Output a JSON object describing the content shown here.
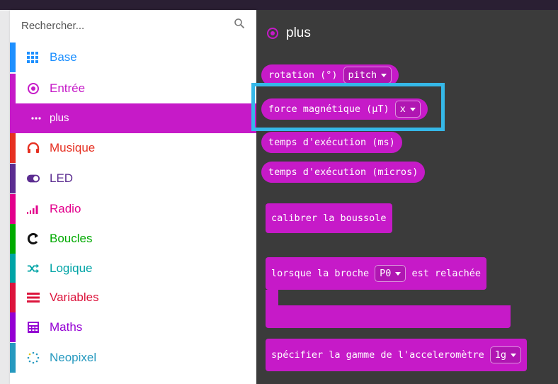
{
  "search": {
    "placeholder": "Rechercher..."
  },
  "categories": [
    {
      "label": "Base",
      "color": "#1e90ff",
      "icon": "grid-icon"
    },
    {
      "label": "Entrée",
      "color": "#c61ac8",
      "icon": "radio-target-icon"
    },
    {
      "label": "plus",
      "color": "#c61ac8",
      "icon": "more-dots-icon",
      "selected": true
    },
    {
      "label": "Musique",
      "color": "#e63022",
      "icon": "headphones-icon"
    },
    {
      "label": "LED",
      "color": "#5c2d91",
      "icon": "toggle-icon"
    },
    {
      "label": "Radio",
      "color": "#e3008c",
      "icon": "signal-bars-icon"
    },
    {
      "label": "Boucles",
      "color": "#00aa00",
      "icon": "loop-icon"
    },
    {
      "label": "Logique",
      "color": "#00a4a6",
      "icon": "shuffle-icon"
    },
    {
      "label": "Variables",
      "color": "#dc143c",
      "icon": "lines-icon"
    },
    {
      "label": "Maths",
      "color": "#9400d3",
      "icon": "calculator-icon"
    },
    {
      "label": "Neopixel",
      "color": "#2699bf",
      "icon": "dotted-circle-icon"
    }
  ],
  "flyout": {
    "title": "plus",
    "blocks": {
      "rotation": {
        "text": "rotation (°)",
        "dropdown": "pitch"
      },
      "force": {
        "text": "force magnétique (µT)",
        "dropdown": "x"
      },
      "temps_ms": {
        "text": "temps d'exécution (ms)"
      },
      "temps_micros": {
        "text": "temps d'exécution (micros)"
      },
      "calibrer": {
        "text": "calibrer la boussole"
      },
      "lorsque": {
        "text_before": "lorsque la broche",
        "dropdown": "P0",
        "text_after": "est relachée"
      },
      "specifier": {
        "text": "spécifier la gamme de l'acceleromètre",
        "dropdown": "1g"
      }
    }
  },
  "colors": {
    "block": "#c61ac8",
    "highlight": "#35b8e8",
    "workspace": "#3b3b3b"
  }
}
